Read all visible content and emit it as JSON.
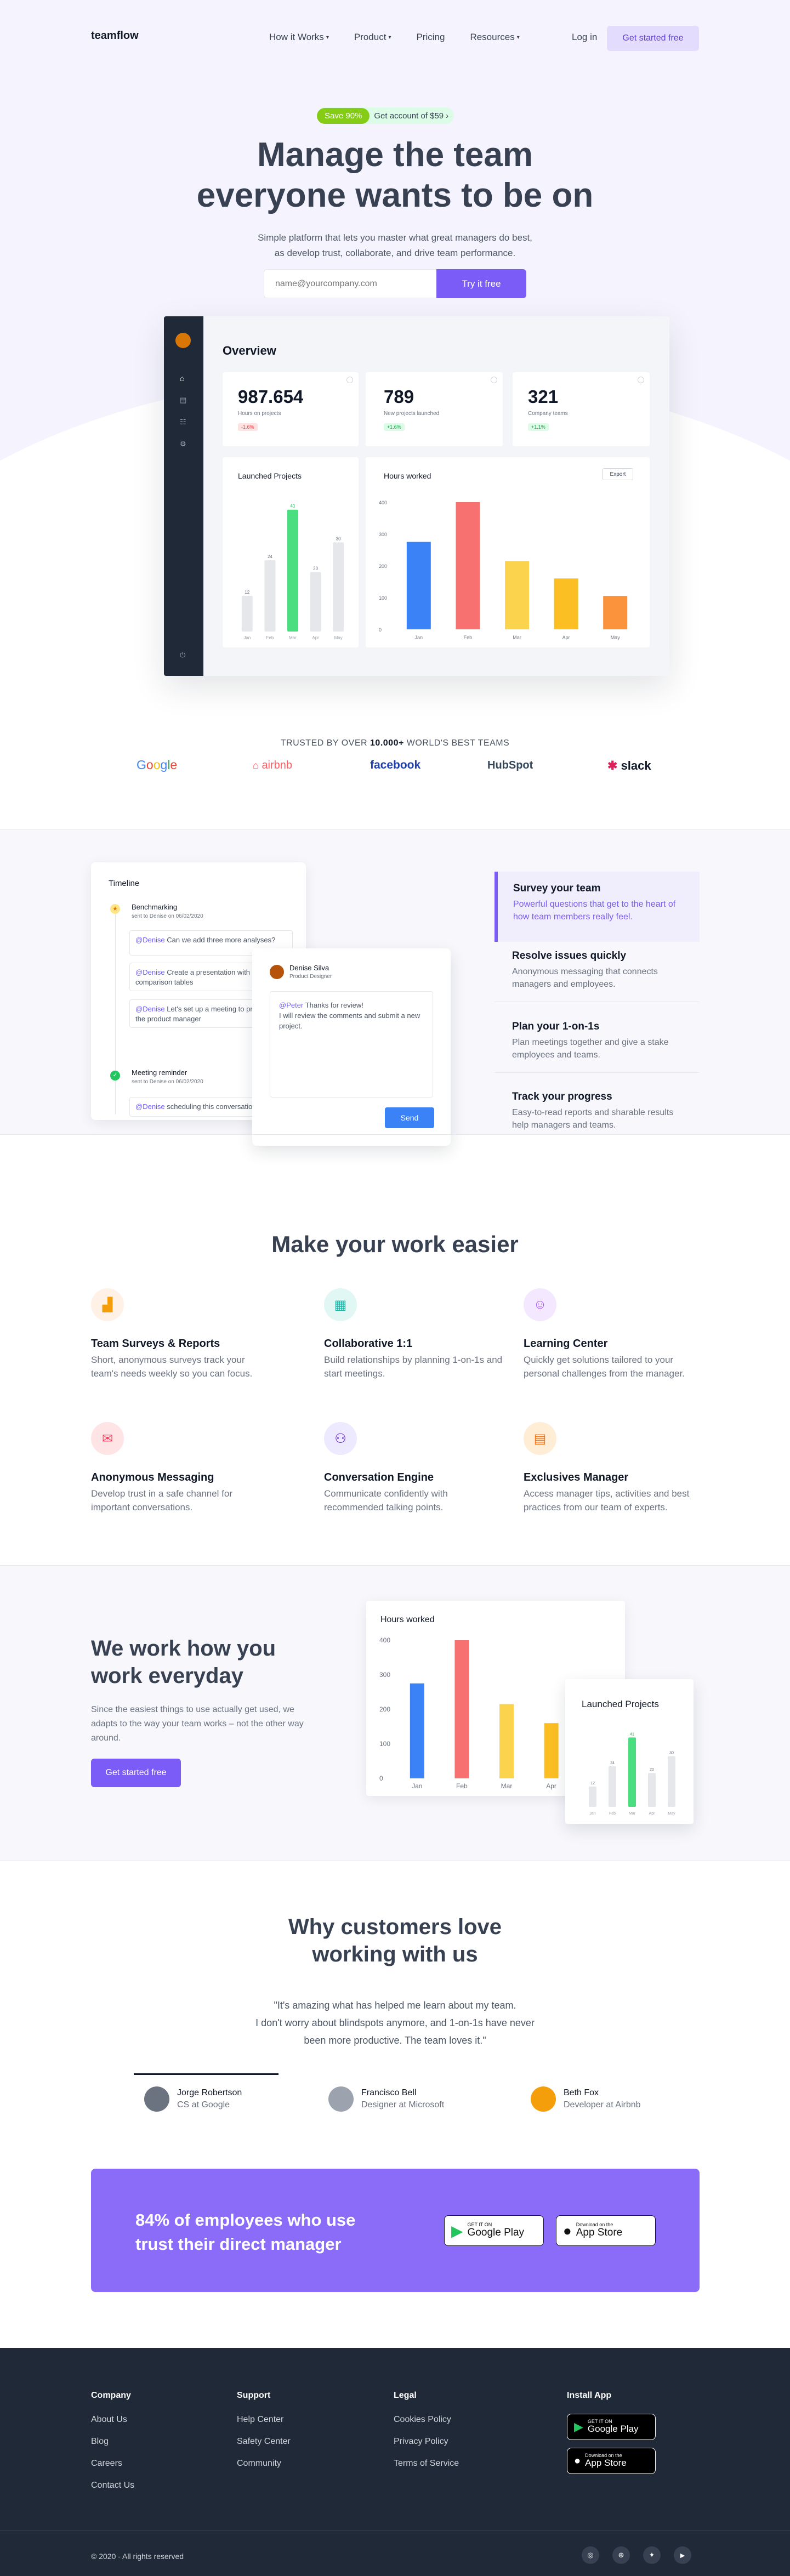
{
  "brand": "teamflow",
  "nav": {
    "items": [
      "How it Works",
      "Product",
      "Pricing",
      "Resources"
    ],
    "login": "Log in",
    "cta": "Get started free"
  },
  "hero": {
    "badge": "Save 90%",
    "badge_text": "Get account of $59",
    "title1": "Manage the team",
    "title2": "everyone wants to be on",
    "sub1": "Simple platform that lets you master what great managers do best,",
    "sub2": "as develop trust, collaborate, and drive team performance.",
    "email_placeholder": "name@yourcompany.com",
    "button": "Try it free"
  },
  "dashboard": {
    "title": "Overview",
    "stats": [
      {
        "value": "987.654",
        "label": "Hours on projects",
        "chip": "-1.6%",
        "chip_color": "#ef4444",
        "chip_bg": "#fee2e2"
      },
      {
        "value": "789",
        "label": "New projects launched",
        "chip": "+1.6%",
        "chip_color": "#16a34a",
        "chip_bg": "#dcfce7"
      },
      {
        "value": "321",
        "label": "Company teams",
        "chip": "+1.1%",
        "chip_color": "#16a34a",
        "chip_bg": "#dcfce7"
      }
    ],
    "launched_title": "Launched Projects",
    "hours_title": "Hours worked",
    "export": "Export"
  },
  "chart_data": [
    {
      "type": "bar",
      "title": "Launched Projects",
      "categories": [
        "Jan",
        "Feb",
        "Mar",
        "Apr",
        "May"
      ],
      "values": [
        12,
        24,
        41,
        20,
        30
      ],
      "highlight": "Mar",
      "colors": {
        "base": "#e5e7eb",
        "highlight": "#4ade80"
      }
    },
    {
      "type": "bar",
      "title": "Hours worked",
      "categories": [
        "Jan",
        "Feb",
        "Mar",
        "Apr",
        "May"
      ],
      "values": [
        275,
        400,
        215,
        160,
        105
      ],
      "yticks": [
        0,
        100,
        200,
        300,
        400
      ],
      "ylim": [
        0,
        400
      ],
      "colors": [
        "#3b82f6",
        "#f87171",
        "#fcd34d",
        "#fbbf24",
        "#fb923c"
      ]
    }
  ],
  "trusted": {
    "prefix": "TRUSTED BY OVER ",
    "count": "10.000+",
    "suffix": " WORLD'S BEST TEAMS",
    "logos": [
      "Google",
      "airbnb",
      "facebook",
      "HubSpot",
      "slack"
    ]
  },
  "timeline": {
    "title": "Timeline",
    "item1_title": "Benchmarking",
    "item1_sub": "sent to Denise on 06/02/2020",
    "msg1_mention": "@Denise",
    "msg1": " Can we add three more analyses?",
    "msg2_mention": "@Denise",
    "msg2": " Create a presentation with comparison tables",
    "msg3_mention": "@Denise",
    "msg3": " Let's set up a meeting to present to the product manager",
    "item2_title": "Meeting reminder",
    "item2_sub": "sent to Denise on 06/02/2020",
    "msg4_mention": "@Denise",
    "msg4": " scheduling this conversation"
  },
  "chat": {
    "name": "Denise Silva",
    "role": "Product Designer",
    "mention": "@Peter",
    "line1": " Thanks for review!",
    "line2": "I will review the comments and submit a new project.",
    "send": "Send"
  },
  "features_side": [
    {
      "title": "Survey your team",
      "text": "Powerful questions that get to the heart of how team members really feel.",
      "active": true
    },
    {
      "title": "Resolve issues quickly",
      "text": "Anonymous messaging that connects managers and employees.",
      "active": false
    },
    {
      "title": "Plan your 1-on-1s",
      "text": "Plan meetings together and give a stake employees and teams.",
      "active": false
    },
    {
      "title": "Track your progress",
      "text": "Easy-to-read reports and sharable results help managers and teams.",
      "active": false
    }
  ],
  "easier": {
    "title": "Make your work easier",
    "items": [
      {
        "title": "Team Surveys & Reports",
        "text": "Short, anonymous surveys track your team's needs weekly so you can focus.",
        "icon": "chart-icon",
        "bg": "#fff1e6"
      },
      {
        "title": "Collaborative 1:1",
        "text": "Build relationships by planning 1-on-1s and start meetings.",
        "icon": "calendar-icon",
        "bg": "#e0f7f4"
      },
      {
        "title": "Learning Center",
        "text": "Quickly get solutions tailored to your personal challenges from the manager.",
        "icon": "person-icon",
        "bg": "#f3e8ff"
      },
      {
        "title": "Anonymous Messaging",
        "text": "Develop trust in a safe channel for important conversations.",
        "icon": "message-icon",
        "bg": "#ffe4e6"
      },
      {
        "title": "Conversation Engine",
        "text": "Communicate confidently with recommended talking points.",
        "icon": "network-icon",
        "bg": "#ede9fe"
      },
      {
        "title": "Exclusives Manager",
        "text": "Access manager tips, activities and best practices from our team of experts.",
        "icon": "document-icon",
        "bg": "#ffedd5"
      }
    ]
  },
  "workhow": {
    "title1": "We work how you",
    "title2": "work everyday",
    "text": "Since the easiest things to use actually get used, we adapts to the way your team works – not the other way around.",
    "button": "Get started free",
    "hours_title": "Hours worked",
    "launched_title": "Launched Projects"
  },
  "testimonials": {
    "title1": "Why customers love",
    "title2": "working with us",
    "quote1": "\"It's amazing what has helped me learn about my team.",
    "quote2": "I don't worry about blindspots anymore, and 1-on-1s have never",
    "quote3": "been more productive. The team loves it.\"",
    "people": [
      {
        "name": "Jorge Robertson",
        "role": "CS at Google",
        "color": "#6b7280"
      },
      {
        "name": "Francisco Bell",
        "role": "Designer at Microsoft",
        "color": "#9ca3af"
      },
      {
        "name": "Beth Fox",
        "role": "Developer at Airbnb",
        "color": "#f59e0b"
      }
    ]
  },
  "cta": {
    "line1": "84% of employees who use",
    "line2": "trust their direct manager",
    "gp_small": "GET IT ON",
    "gp_big": "Google Play",
    "as_small": "Download on the",
    "as_big": "App Store"
  },
  "footer": {
    "cols": [
      {
        "title": "Company",
        "links": [
          "About Us",
          "Blog",
          "Careers",
          "Contact Us"
        ]
      },
      {
        "title": "Support",
        "links": [
          "Help Center",
          "Safety Center",
          "Community"
        ]
      },
      {
        "title": "Legal",
        "links": [
          "Cookies Policy",
          "Privacy Policy",
          "Terms of Service"
        ]
      }
    ],
    "install": "Install App",
    "copyright": "© 2020 - All rights reserved",
    "social": [
      "instagram-icon",
      "dribbble-icon",
      "twitter-icon",
      "youtube-icon"
    ]
  }
}
